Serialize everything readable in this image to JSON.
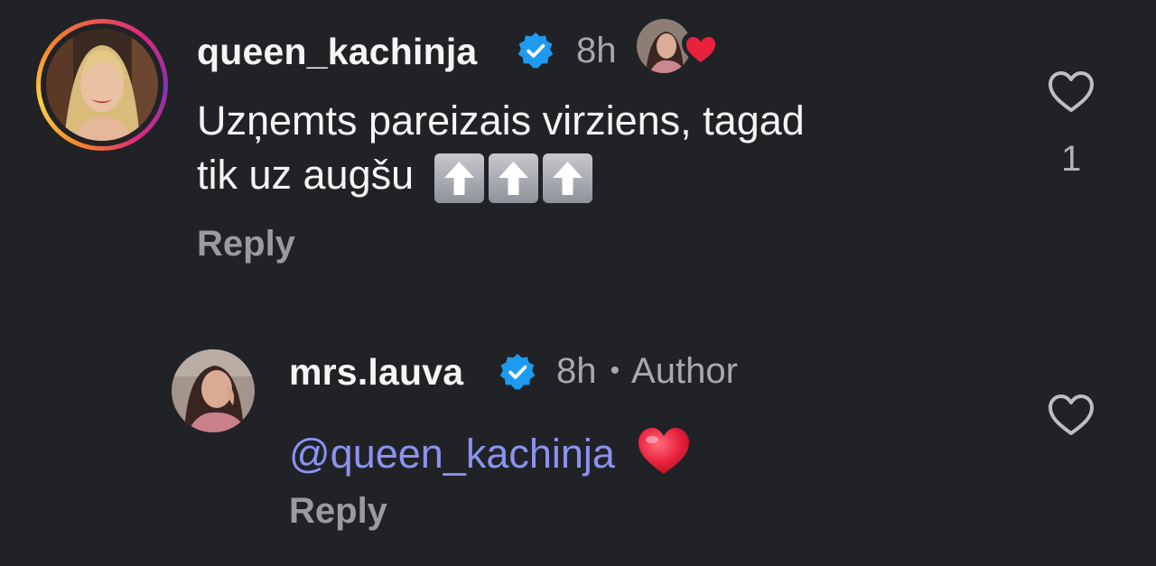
{
  "comment": {
    "username": "queen_kachinja",
    "time": "8h",
    "text_line1": "Uzņemts pareizais virziens, tagad",
    "text_line2": "tik uz augšu",
    "emoji": [
      "up-arrow",
      "up-arrow",
      "up-arrow"
    ],
    "reply_label": "Reply",
    "like_count": "1",
    "liked_by_author": true
  },
  "reply": {
    "username": "mrs.lauva",
    "time": "8h",
    "separator": "•",
    "author_badge": "Author",
    "mention": "@queen_kachinja",
    "emoji": "red-heart",
    "reply_label": "Reply"
  },
  "colors": {
    "background": "#212226",
    "verified": "#1d9bf0",
    "mention": "#8c92f0",
    "heart": "#e8223c"
  }
}
